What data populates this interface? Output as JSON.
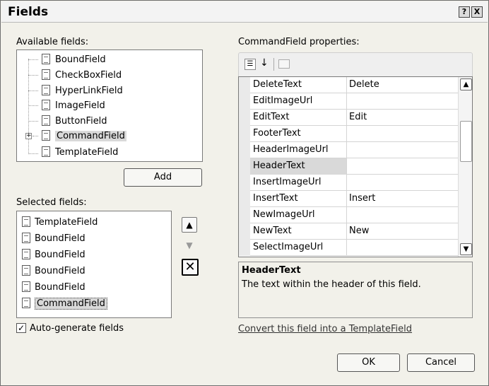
{
  "window": {
    "title": "Fields",
    "help_button": "?",
    "close_button": "X"
  },
  "available": {
    "label": "Available fields:",
    "items": [
      {
        "label": "BoundField",
        "icon": "bound-field-icon"
      },
      {
        "label": "CheckBoxField",
        "icon": "checkbox-field-icon"
      },
      {
        "label": "HyperLinkField",
        "icon": "hyperlink-field-icon"
      },
      {
        "label": "ImageField",
        "icon": "image-field-icon"
      },
      {
        "label": "ButtonField",
        "icon": "button-field-icon"
      },
      {
        "label": "CommandField",
        "icon": "command-field-icon",
        "selected": true,
        "expander": "+"
      },
      {
        "label": "TemplateField",
        "icon": "template-field-icon"
      }
    ],
    "add_button": "Add"
  },
  "selected": {
    "label": "Selected fields:",
    "items": [
      {
        "label": "TemplateField",
        "icon": "template-field-icon"
      },
      {
        "label": "BoundField",
        "icon": "bound-field-icon"
      },
      {
        "label": "BoundField",
        "icon": "bound-field-icon"
      },
      {
        "label": "BoundField",
        "icon": "bound-field-icon"
      },
      {
        "label": "BoundField",
        "icon": "bound-field-icon"
      },
      {
        "label": "CommandField",
        "icon": "command-field-icon",
        "selected": true
      }
    ],
    "move_up_icon": "arrow-up-icon",
    "move_down_icon": "arrow-down-icon",
    "delete_icon": "delete-x-icon"
  },
  "autogen": {
    "label": "Auto-generate fields",
    "checked": true
  },
  "properties": {
    "label": "CommandField properties:",
    "toolbar_icons": [
      "categorized-icon",
      "alphabetical-sort-icon",
      "property-pages-icon"
    ],
    "rows": [
      {
        "name": "DeleteText",
        "value": "Delete"
      },
      {
        "name": "EditImageUrl",
        "value": ""
      },
      {
        "name": "EditText",
        "value": "Edit"
      },
      {
        "name": "FooterText",
        "value": ""
      },
      {
        "name": "HeaderImageUrl",
        "value": ""
      },
      {
        "name": "HeaderText",
        "value": "",
        "highlighted": true
      },
      {
        "name": "InsertImageUrl",
        "value": ""
      },
      {
        "name": "InsertText",
        "value": "Insert"
      },
      {
        "name": "NewImageUrl",
        "value": ""
      },
      {
        "name": "NewText",
        "value": "New"
      },
      {
        "name": "SelectImageUrl",
        "value": ""
      }
    ],
    "description_title": "HeaderText",
    "description_text": "The text within the header of this field."
  },
  "convert_link": "Convert this field into a TemplateField",
  "buttons": {
    "ok": "OK",
    "cancel": "Cancel"
  },
  "colors": {
    "dialog_bg": "#f2f1ea",
    "highlight": "#d9d9d9"
  }
}
